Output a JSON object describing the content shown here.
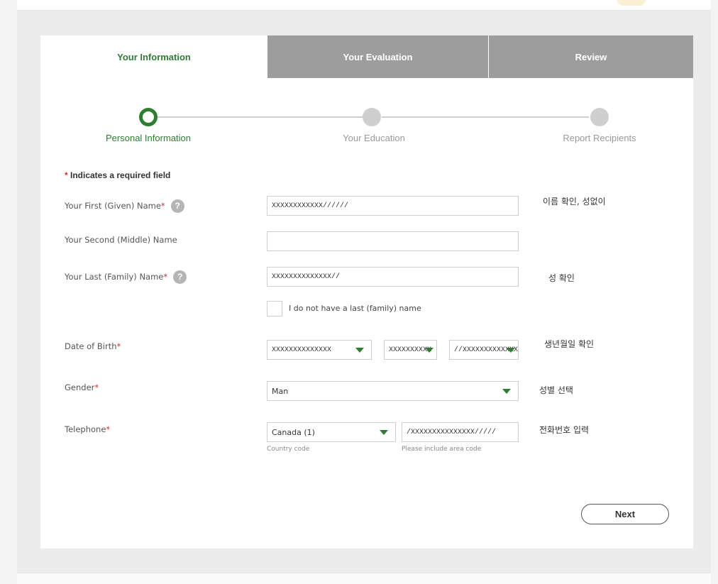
{
  "tabs": [
    {
      "label": "Your Information",
      "active": true
    },
    {
      "label": "Your Evaluation",
      "active": false
    },
    {
      "label": "Review",
      "active": false
    }
  ],
  "steps": [
    {
      "label": "Personal Information",
      "state": "current"
    },
    {
      "label": "Your Education",
      "state": "upcoming"
    },
    {
      "label": "Report Recipients",
      "state": "upcoming"
    }
  ],
  "required_note": {
    "star": "*",
    "text": " Indicates a required field"
  },
  "form": {
    "first_name": {
      "label": "Your First (Given) Name",
      "required": "*",
      "help": "?",
      "value": "XXXXXXXXXXXX//////"
    },
    "middle_name": {
      "label": "Your Second (Middle) Name",
      "value": ""
    },
    "last_name": {
      "label": "Your Last (Family) Name",
      "required": "*",
      "help": "?",
      "value": "XXXXXXXXXXXXXX//"
    },
    "no_last_name": {
      "label": "I do not have a last (family) name",
      "checked": false
    },
    "dob": {
      "label": "Date of Birth",
      "required": "*",
      "month": "XXXXXXXXXXXXXX",
      "day": "XXXXXXXXXX",
      "year": "//XXXXXXXXXXXXXX//"
    },
    "gender": {
      "label": "Gender",
      "required": "*",
      "value": "Man"
    },
    "telephone": {
      "label": "Telephone",
      "required": "*",
      "country": "Canada (1)",
      "country_hint": "Country code",
      "number": "/XXXXXXXXXXXXXXX/////",
      "number_hint": "Please include area code"
    }
  },
  "notes": {
    "name": "이름 확인, 성없이",
    "last_name": "성 확인",
    "dob": "생년월일 확인",
    "gender": "성별 선택",
    "phone": "전화번호 입력"
  },
  "buttons": {
    "next": "Next"
  },
  "colors": {
    "accent": "#2e7d32",
    "tab_inactive": "#9d9d9d",
    "required": "#d32f2f"
  }
}
